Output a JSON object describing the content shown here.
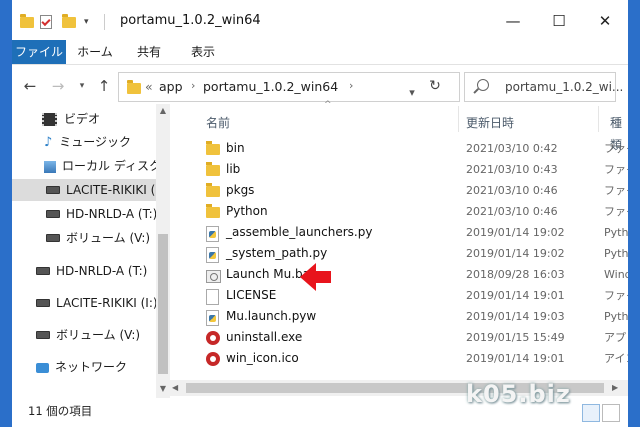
{
  "window": {
    "title": "portamu_1.0.2_win64"
  },
  "ribbon": {
    "tabs": [
      "ファイル",
      "ホーム",
      "共有",
      "表示"
    ]
  },
  "controls": {
    "minimize": "—",
    "maximize": "☐",
    "close": "✕"
  },
  "address": {
    "overflow": "«",
    "crumbs": [
      "app",
      "portamu_1.0.2_win64"
    ]
  },
  "search": {
    "placeholder": "portamu_1.0.2_wi..."
  },
  "nav": {
    "items": [
      {
        "label": "ビデオ",
        "icon": "video-icon"
      },
      {
        "label": "ミュージック",
        "icon": "music-icon"
      },
      {
        "label": "ローカル ディスク (C:",
        "icon": "drive-icon"
      },
      {
        "label": "LACITE-RIKIKI (I:)",
        "icon": "drive-icon",
        "selected": true
      },
      {
        "label": "HD-NRLD-A (T:)",
        "icon": "drive-icon"
      },
      {
        "label": "ボリューム (V:)",
        "icon": "drive-icon"
      },
      {
        "label": "HD-NRLD-A (T:)",
        "icon": "drive-icon"
      },
      {
        "label": "LACITE-RIKIKI (I:)",
        "icon": "drive-icon"
      },
      {
        "label": "ボリューム (V:)",
        "icon": "drive-icon"
      },
      {
        "label": "ネットワーク",
        "icon": "network-icon"
      }
    ]
  },
  "columns": {
    "name": "名前",
    "date": "更新日時",
    "type": "種類"
  },
  "files": [
    {
      "name": "bin",
      "date": "2021/03/10 0:42",
      "type": "ファイ",
      "icon": "folder"
    },
    {
      "name": "lib",
      "date": "2021/03/10 0:43",
      "type": "ファイ",
      "icon": "folder"
    },
    {
      "name": "pkgs",
      "date": "2021/03/10 0:46",
      "type": "ファイ",
      "icon": "folder"
    },
    {
      "name": "Python",
      "date": "2021/03/10 0:46",
      "type": "ファイ",
      "icon": "folder"
    },
    {
      "name": "_assemble_launchers.py",
      "date": "2019/01/14 19:02",
      "type": "Pytho",
      "icon": "py"
    },
    {
      "name": "_system_path.py",
      "date": "2019/01/14 19:02",
      "type": "Pytho",
      "icon": "py"
    },
    {
      "name": "Launch Mu.bat",
      "date": "2018/09/28 16:03",
      "type": "Wind",
      "icon": "bat"
    },
    {
      "name": "LICENSE",
      "date": "2019/01/14 19:01",
      "type": "ファイ",
      "icon": "doc"
    },
    {
      "name": "Mu.launch.pyw",
      "date": "2019/01/14 19:03",
      "type": "Pytho",
      "icon": "py"
    },
    {
      "name": "uninstall.exe",
      "date": "2019/01/15 15:49",
      "type": "アプリ",
      "icon": "exe"
    },
    {
      "name": "win_icon.ico",
      "date": "2019/01/14 19:01",
      "type": "アイコ",
      "icon": "ico"
    }
  ],
  "status": {
    "text": "11 個の項目"
  },
  "watermark": "k05.biz",
  "colors": {
    "accent": "#1e6fb8",
    "arrow": "#e8141c",
    "folder": "#f0c23c"
  }
}
